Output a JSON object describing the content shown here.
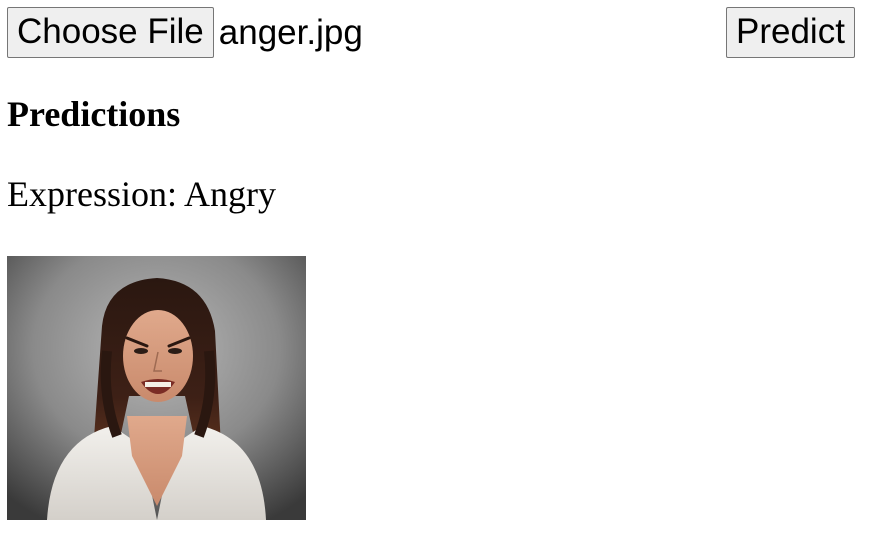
{
  "file_input": {
    "button_label": "Choose File",
    "selected_file": "anger.jpg"
  },
  "predict_button": {
    "label": "Predict"
  },
  "predictions": {
    "heading": "Predictions",
    "expression_label": "Expression:",
    "expression_value": "Angry"
  },
  "image": {
    "alt": "anger.jpg",
    "content": "woman with angry facial expression"
  }
}
